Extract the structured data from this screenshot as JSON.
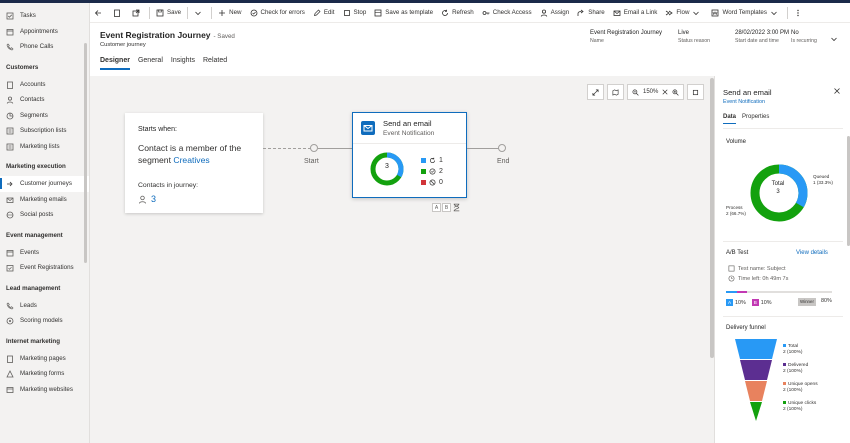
{
  "sidebar": {
    "top_items": [
      "Tasks",
      "Appointments",
      "Phone Calls"
    ],
    "groups": [
      {
        "label": "Customers",
        "items": [
          "Accounts",
          "Contacts",
          "Segments",
          "Subscription lists",
          "Marketing lists"
        ]
      },
      {
        "label": "Marketing execution",
        "items": [
          "Customer journeys",
          "Marketing emails",
          "Social posts"
        ]
      },
      {
        "label": "Event management",
        "items": [
          "Events",
          "Event Registrations"
        ]
      },
      {
        "label": "Lead management",
        "items": [
          "Leads",
          "Scoring models"
        ]
      },
      {
        "label": "Internet marketing",
        "items": [
          "Marketing pages",
          "Marketing forms",
          "Marketing websites"
        ]
      }
    ],
    "active_item": "Customer journeys"
  },
  "commandbar": {
    "save": "Save",
    "new": "New",
    "check_errors": "Check for errors",
    "edit": "Edit",
    "stop": "Stop",
    "save_template": "Save as template",
    "refresh": "Refresh",
    "check_access": "Check Access",
    "assign": "Assign",
    "share": "Share",
    "email_link": "Email a Link",
    "flow": "Flow",
    "word_templates": "Word Templates"
  },
  "header": {
    "title": "Event Registration Journey",
    "saved": "- Saved",
    "entity": "Customer journey",
    "fields": [
      {
        "value": "Event Registration Journey",
        "label": "Name"
      },
      {
        "value": "Live",
        "label": "Status reason"
      },
      {
        "value": "28/02/2022 3:00 PM",
        "label": "Start date and time"
      },
      {
        "value": "No",
        "label": "Is recurring"
      }
    ]
  },
  "tabs": [
    "Designer",
    "General",
    "Insights",
    "Related"
  ],
  "active_tab": "Designer",
  "canvas": {
    "zoom": "150%",
    "trigger": {
      "heading": "Starts when:",
      "text_prefix": "Contact is a member of the segment",
      "segment": "Creatives",
      "contacts_label": "Contacts in journey:",
      "contacts_count": "3"
    },
    "start_label": "Start",
    "end_label": "End",
    "email_tile": {
      "title": "Send an email",
      "subtitle": "Event Notification",
      "total": "3",
      "stats": [
        {
          "value": "1",
          "color": "#2899f5"
        },
        {
          "value": "2",
          "color": "#13a10e"
        },
        {
          "value": "0",
          "color": "#d13438"
        }
      ],
      "ab_chips": [
        "A",
        "B"
      ]
    }
  },
  "panel": {
    "title": "Send an email",
    "subtitle": "Event Notification",
    "tabs": [
      "Data",
      "Properties"
    ],
    "active_tab": "Data",
    "volume": {
      "heading": "Volume",
      "total_label": "Total",
      "total_value": "3",
      "queued_label": "Queued",
      "queued_value": "1 (33.3%)",
      "process_label": "Process",
      "process_value": "2 (66.7%)",
      "queued_fraction": 0.333,
      "colors": {
        "queued": "#2899f5",
        "process": "#13a10e"
      }
    },
    "ab_test": {
      "heading": "A/B Test",
      "view_details": "View details",
      "test_name": "Test name: Subject",
      "time_left": "Time left: 0h 49m 7s",
      "a_pct": "10%",
      "b_pct": "10%",
      "winner_label": "Winner",
      "winner_pct": "80%",
      "a_fraction": 0.1,
      "b_fraction": 0.1
    },
    "funnel": {
      "heading": "Delivery funnel",
      "stages": [
        {
          "label": "Total",
          "value": "2 (100%)",
          "color": "#2899f5"
        },
        {
          "label": "Delivered",
          "value": "2 (100%)",
          "color": "#5c2e91"
        },
        {
          "label": "Unique opens",
          "value": "2 (100%)",
          "color": "#e8825e"
        },
        {
          "label": "Unique clicks",
          "value": "2 (100%)",
          "color": "#13a10e"
        }
      ]
    }
  }
}
